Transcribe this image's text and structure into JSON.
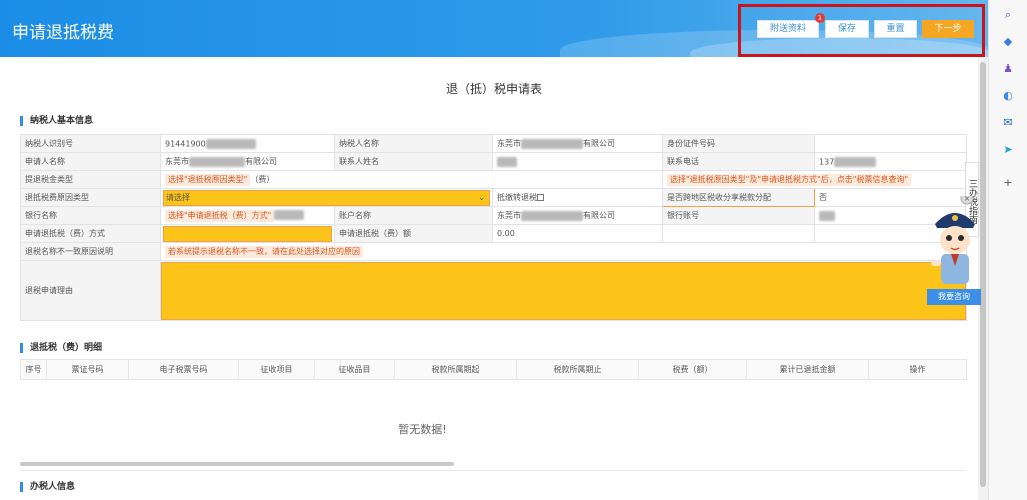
{
  "header": {
    "title": "申请退抵税费",
    "buttons": {
      "attach": "附送资料",
      "save": "保存",
      "reset": "重置",
      "next": "下一步"
    },
    "notification_count": "1"
  },
  "doc_title": "退（抵）税申请表",
  "sections": {
    "taxpayer": "纳税人基本信息",
    "detail": "退抵税（费）明细",
    "handler": "办税人信息"
  },
  "form": {
    "taxpayer_id_label": "纳税人识别号",
    "taxpayer_id_value": "91441900",
    "taxpayer_name_label": "纳税人名称",
    "taxpayer_name_prefix": "东莞市",
    "taxpayer_name_suffix": "有限公司",
    "id_doc_label": "身份证件号码",
    "applicant_label": "申请人名称",
    "applicant_prefix": "东莞市",
    "applicant_suffix": "有限公司",
    "contact_label": "联系人姓名",
    "phone_label": "联系电话",
    "phone_value": "137",
    "refund_type_label": "提退税金类型",
    "refund_type_hint": "选择\"退抵税原因类型\"",
    "refund_type_suffix": "（费）",
    "refund_type_note": "选择\"退抵税原因类型\"及\"申请退抵税方式\"后，点击\"税票信息查询\"",
    "reason_type_label": "退抵税费原因类型",
    "reason_type_value": "请选择",
    "convert_label": "抵缴转退税",
    "cross_region_label": "是否跨地区税收分享税款分配",
    "cross_region_value": "否",
    "bank_label": "银行名称",
    "bank_hint": "选择\"申请退抵税（费）方式\"",
    "account_name_label": "账户名称",
    "account_name_prefix": "东莞市",
    "account_name_suffix": "有限公司",
    "bank_account_label": "银行账号",
    "method_label": "申请退抵税（费）方式",
    "amount_label": "申请退抵税（费）额",
    "amount_value": "0.00",
    "name_mismatch_label": "退税名称不一致原因说明",
    "name_mismatch_hint": "若系统提示退税名称不一致，请在此处选择对应的原因",
    "reason_label": "退税申请理由"
  },
  "detail_table": {
    "headers": [
      "序号",
      "票证号码",
      "电子税票号码",
      "征收项目",
      "征收品目",
      "税款所属期起",
      "税款所属期止",
      "税费（额）",
      "累计已退抵金额",
      "操作"
    ],
    "empty_text": "暂无数据!"
  },
  "side": {
    "tab_text": "三办税指南",
    "consult_label": "我要咨询"
  },
  "colors": {
    "header_blue": "#1c8de6",
    "accent_orange": "#f5a623",
    "highlight_yellow": "#fcc419",
    "frame_red": "#c8161d"
  },
  "browser_sidebar_icons": [
    "search-icon",
    "tag-icon",
    "people-icon",
    "copilot-icon",
    "outlook-icon",
    "send-icon",
    "plus-icon"
  ]
}
